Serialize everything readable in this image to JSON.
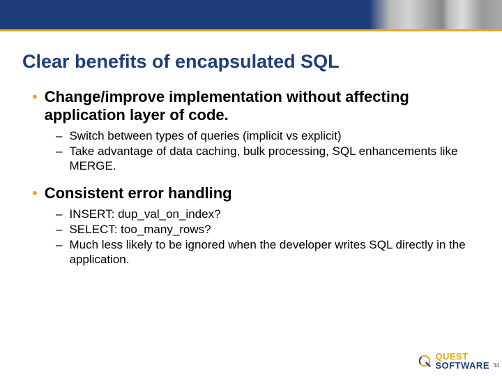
{
  "slide": {
    "title": "Clear benefits of encapsulated SQL",
    "bullets": [
      {
        "text": "Change/improve implementation without affecting application layer of code.",
        "sub": [
          "Switch between types of queries (implicit vs explicit)",
          "Take advantage of data caching, bulk processing, SQL enhancements like MERGE."
        ]
      },
      {
        "text": "Consistent error handling",
        "sub": [
          "INSERT: dup_val_on_index?",
          "SELECT: too_many_rows?",
          "Much less likely to be ignored when the developer writes SQL directly in the application."
        ]
      }
    ],
    "footer": {
      "logo_top": "QUEST",
      "logo_bottom": "SOFTWARE",
      "page_number": "34"
    }
  }
}
